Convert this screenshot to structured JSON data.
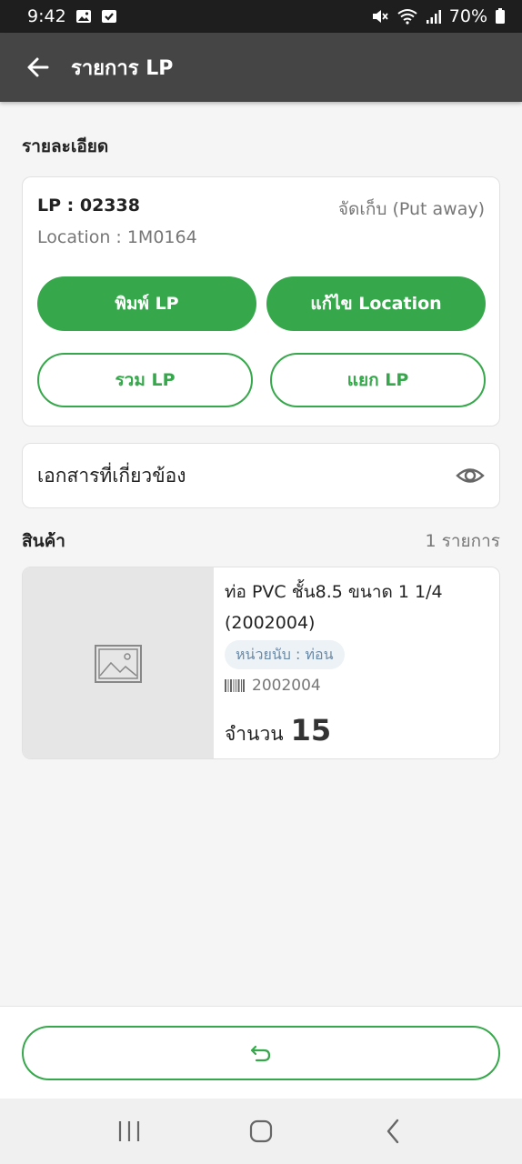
{
  "status_bar": {
    "time": "9:42",
    "battery": "70%"
  },
  "app_bar": {
    "title": "รายการ LP"
  },
  "details": {
    "section_title": "รายละเอียด",
    "lp_number": "LP : 02338",
    "status": "จัดเก็บ (Put away)",
    "location": "Location :  1M0164",
    "buttons": {
      "print_lp": "พิมพ์ LP",
      "edit_location": "แก้ไข Location",
      "merge_lp": "รวม LP",
      "split_lp": "แยก LP"
    }
  },
  "documents": {
    "label": "เอกสารที่เกี่ยวข้อง"
  },
  "products": {
    "title": "สินค้า",
    "count": "1 รายการ",
    "items": [
      {
        "name": "ท่อ PVC ชั้น8.5 ขนาด 1 1/4 (2002004)",
        "unit": "หน่วยนับ : ท่อน",
        "barcode": "2002004",
        "quantity_label": "จำนวน",
        "quantity": "15"
      }
    ]
  },
  "colors": {
    "primary_green": "#36a84b",
    "app_bar": "#454545",
    "badge_bg": "#edf2f6",
    "badge_text": "#6b8aa6"
  },
  "icons": {
    "back": "arrow-left-icon",
    "eye": "eye-icon",
    "image_placeholder": "image-placeholder-icon",
    "barcode": "barcode-icon",
    "undo": "undo-icon"
  }
}
